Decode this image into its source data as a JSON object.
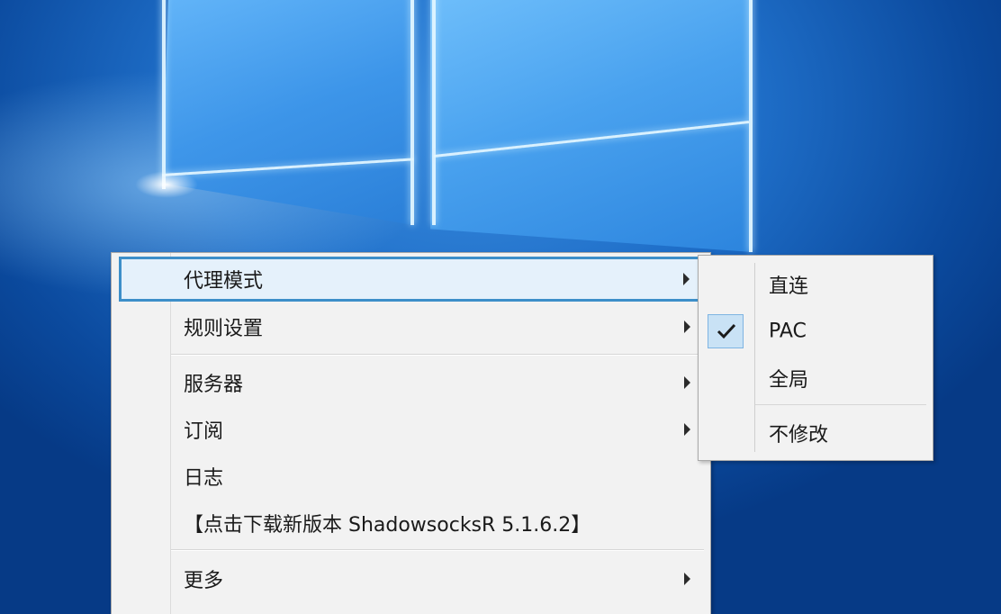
{
  "context_menu": {
    "items": [
      {
        "label": "代理模式",
        "has_submenu": true,
        "highlighted": true
      },
      {
        "label": "规则设置",
        "has_submenu": true
      },
      {
        "label": "服务器",
        "has_submenu": true
      },
      {
        "label": "订阅",
        "has_submenu": true
      },
      {
        "label": "日志",
        "has_submenu": false
      },
      {
        "label": "【点击下载新版本 ShadowsocksR 5.1.6.2】",
        "has_submenu": false
      },
      {
        "label": "更多",
        "has_submenu": true
      }
    ]
  },
  "proxy_mode_submenu": {
    "items": [
      {
        "label": "直连",
        "checked": false
      },
      {
        "label": "PAC",
        "checked": true
      },
      {
        "label": "全局",
        "checked": false
      },
      {
        "label": "不修改",
        "checked": false
      }
    ]
  },
  "icons": {
    "submenu_arrow": "chevron-right-icon",
    "checked": "checkmark-icon"
  },
  "colors": {
    "highlight_border": "#3d8fc9",
    "highlight_fill": "#e5f1fb",
    "check_fill": "#c9e2f5",
    "menu_bg": "#f2f2f2"
  }
}
